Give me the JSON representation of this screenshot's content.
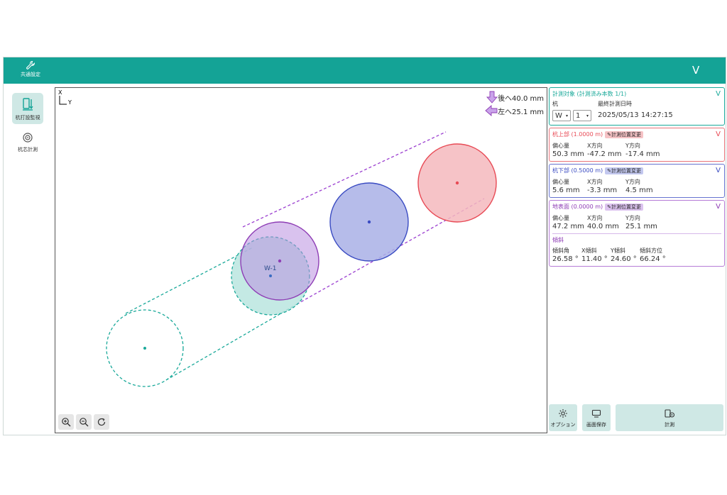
{
  "topbar": {
    "settings_label": "共通設定",
    "menu_chevron": "V"
  },
  "sidebar": {
    "items": [
      {
        "label": "杭打設監視",
        "icon": "pile-monitor-icon",
        "active": true
      },
      {
        "label": "杭芯計測",
        "icon": "target-icon",
        "active": false
      }
    ]
  },
  "canvas": {
    "axis_x": "X",
    "axis_y": "Y",
    "move_back": "後へ40.0 mm",
    "move_left": "左へ25.1 mm",
    "pile_label": "W-1"
  },
  "target": {
    "title": "計測対象 (計測済み本数 1/1)",
    "pile_label": "杭",
    "pile_letter": "W",
    "pile_number": "1",
    "last_label": "最終計測日時",
    "last_value": "2025/05/13 14:27:15",
    "chevron": "V"
  },
  "top_section": {
    "title": "杭上部 (1.0000 m)",
    "chip": "計測位置変更",
    "h_ecc": "偏心量",
    "h_x": "X方向",
    "h_y": "Y方向",
    "ecc": "50.3 mm",
    "x": "-47.2 mm",
    "y": "-17.4 mm",
    "chevron": "V",
    "color": "#e8737a"
  },
  "bottom_section": {
    "title": "杭下部 (0.5000 m)",
    "chip": "計測位置変更",
    "h_ecc": "偏心量",
    "h_x": "X方向",
    "h_y": "Y方向",
    "ecc": "5.6 mm",
    "x": "-3.3 mm",
    "y": "4.5 mm",
    "chevron": "V",
    "color": "#6673d1"
  },
  "ground_section": {
    "title": "地表面 (0.0000 m)",
    "chip": "計測位置変更",
    "h_ecc": "偏心量",
    "h_x": "X方向",
    "h_y": "Y方向",
    "ecc": "47.2 mm",
    "x": "40.0 mm",
    "y": "25.1 mm",
    "incl_title": "傾斜",
    "h_angle": "傾斜角",
    "h_xi": "X傾斜",
    "h_yi": "Y傾斜",
    "h_dir": "傾斜方位",
    "angle": "26.58 °",
    "xi": "11.40 °",
    "yi": "24.60 °",
    "dir": "66.24 °",
    "chevron": "V",
    "color": "#b67cd6"
  },
  "actions": {
    "option": "オプション",
    "save": "画面保存",
    "measure": "計測"
  },
  "colors": {
    "brand": "#14a396",
    "target": "#1aa99a",
    "top": "#e84a55",
    "bottom": "#3a4bc2",
    "ground": "#8e3db5"
  }
}
